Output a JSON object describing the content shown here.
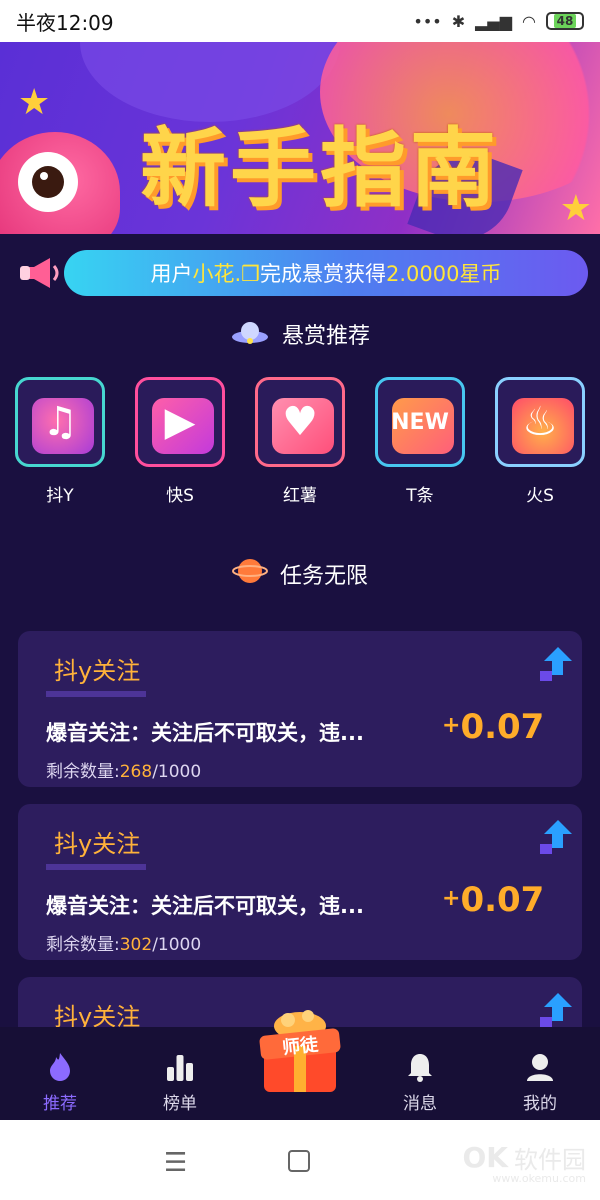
{
  "status_bar": {
    "time": "半夜12:09",
    "battery": "48"
  },
  "banner": {
    "title": "新手指南"
  },
  "notice": {
    "prefix": "用户",
    "user": "小花.❒",
    "middle": "完成悬赏获得",
    "amount": "2.0000星币"
  },
  "section_reward": {
    "title": "悬赏推荐"
  },
  "apps": [
    {
      "label": "抖Y",
      "color": "#47d7d0"
    },
    {
      "label": "快S",
      "color": "#ff4f9d"
    },
    {
      "label": "红薯",
      "color": "#ff6a8a"
    },
    {
      "label": "T条",
      "color": "#48c7f0"
    },
    {
      "label": "火S",
      "color": "#8ad0ff"
    }
  ],
  "section_tasks": {
    "title": "任务无限"
  },
  "tasks": [
    {
      "tag": "抖y关注",
      "desc": "爆音关注：关注后不可取关，违...",
      "reward": "0.07",
      "remain_label": "剩余数量:",
      "remain": "268",
      "total": "/1000"
    },
    {
      "tag": "抖y关注",
      "desc": "爆音关注：关注后不可取关，违...",
      "reward": "0.07",
      "remain_label": "剩余数量:",
      "remain": "302",
      "total": "/1000"
    },
    {
      "tag": "抖y关注"
    }
  ],
  "tabbar": {
    "items": [
      {
        "label": "推荐",
        "icon": "flame-icon"
      },
      {
        "label": "榜单",
        "icon": "chart-icon"
      },
      {
        "label": "消息",
        "icon": "bell-icon"
      },
      {
        "label": "我的",
        "icon": "user-icon"
      }
    ],
    "center": "师徒"
  },
  "watermark": {
    "logo": "OK",
    "text": "软件园",
    "sub": "www.okemu.com"
  }
}
